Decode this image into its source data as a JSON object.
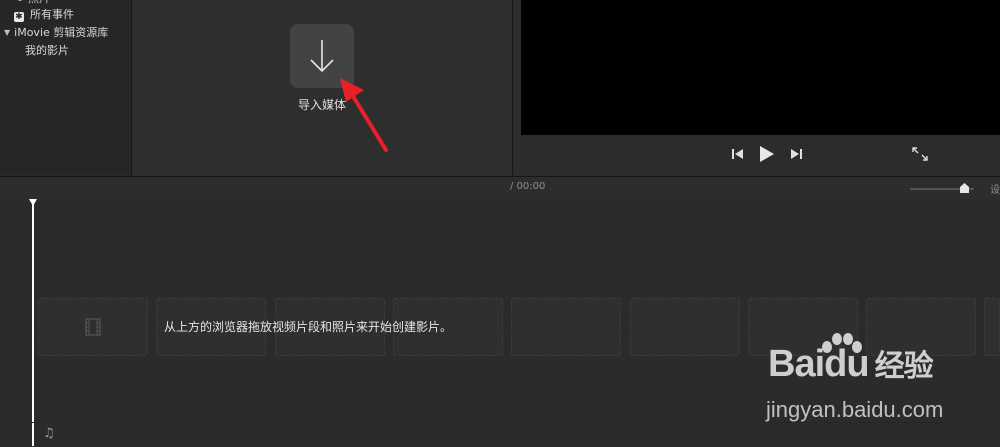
{
  "sidebar": {
    "cut_item": "照片",
    "all_events": "所有事件",
    "library": "iMovie 剪辑资源库",
    "my_movies": "我的影片"
  },
  "browser": {
    "import_label": "导入媒体"
  },
  "viewer": {
    "controls": [
      "skip-back-icon",
      "play-icon",
      "skip-forward-icon",
      "fullscreen-icon"
    ]
  },
  "timeline": {
    "timecode": "/ 00:00",
    "settings_cut": "设",
    "hint": "从上方的浏览器拖放视频片段和照片来开始创建影片。",
    "zoom_level": 0.85
  },
  "watermark": {
    "logo_latin": "Bai",
    "logo_du": "du",
    "logo_cn": "经验",
    "url": "jingyan.baidu.com"
  },
  "colors": {
    "accent_arrow": "#e8202a",
    "screen": "#000000",
    "panel": "#2b2b2b"
  }
}
